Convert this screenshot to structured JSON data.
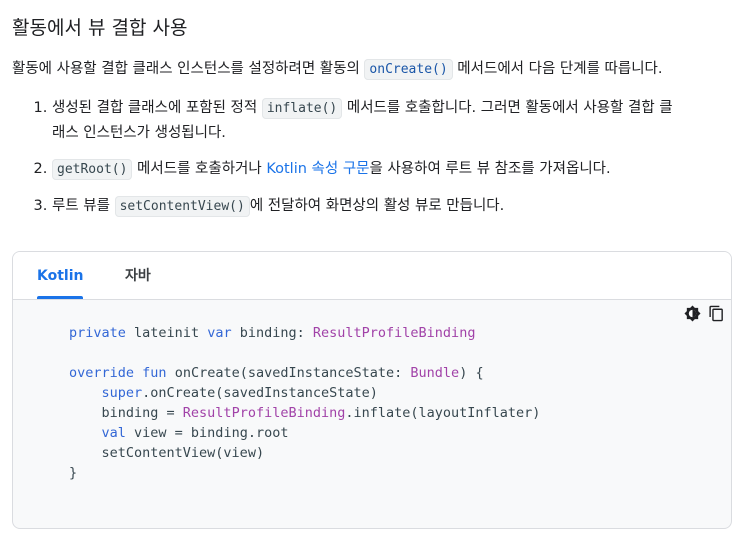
{
  "title": "활동에서 뷰 결합 사용",
  "intro": {
    "before": "활동에 사용할 결합 클래스 인스턴스를 설정하려면 활동의 ",
    "code": "onCreate()",
    "after": " 메서드에서 다음 단계를 따릅니다."
  },
  "steps": [
    {
      "number": "1.",
      "before": "생성된 결합 클래스에 포함된 정적 ",
      "code": "inflate()",
      "after_line1": " 메서드를 호출합니다. 그러면 활동에서 사용할 결합 클",
      "after_line2": "래스 인스턴스가 생성됩니다."
    },
    {
      "number": "2.",
      "code": "getRoot()",
      "middle": " 메서드를 호출하거나 ",
      "link": "Kotlin 속성 구문",
      "after": "을 사용하여 루트 뷰 참조를 가져옵니다."
    },
    {
      "number": "3.",
      "before": "루트 뷰를 ",
      "code": "setContentView()",
      "after": "에 전달하여 화면상의 활성 뷰로 만듭니다."
    }
  ],
  "tabs": {
    "kotlin": "Kotlin",
    "java": "자바"
  },
  "code_tools": {
    "theme_icon": "theme-toggle-icon",
    "copy_icon": "copy-icon"
  },
  "code": {
    "l1": {
      "kw1": "private",
      "s1": " ",
      "kw2": "lateinit",
      "s2": " ",
      "kw3": "var",
      "s3": " binding: ",
      "ty": "ResultProfileBinding"
    },
    "l2": {
      "kw1": "override",
      "s1": " ",
      "kw2": "fun",
      "s2": " onCreate(savedInstanceState: ",
      "ty": "Bundle",
      "s3": ") {"
    },
    "l3": {
      "indent": "    ",
      "kw": "super",
      "rest": ".onCreate(savedInstanceState)"
    },
    "l4": {
      "indent": "    ",
      "pre": "binding = ",
      "ty": "ResultProfileBinding",
      "rest": ".inflate(layoutInflater)"
    },
    "l5": {
      "indent": "    ",
      "kw": "val",
      "rest": " view = binding.root"
    },
    "l6": {
      "indent": "    ",
      "rest": "setContentView(view)"
    },
    "l7": {
      "rest": "}"
    }
  },
  "colors": {
    "accent": "#1a73e8",
    "keyword": "#3367d6",
    "type": "#a142a8",
    "code_text": "#37474f",
    "code_bg": "#f8f9fa"
  }
}
